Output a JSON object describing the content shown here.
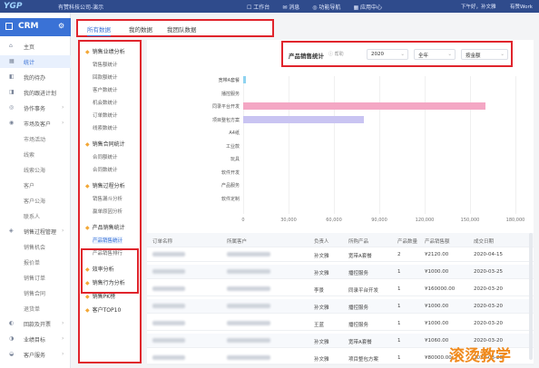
{
  "topbar": {
    "logo": "YGP",
    "company": "有赞科技公司-演示",
    "nav": [
      "工作台",
      "消息",
      "功能导航",
      "应用中心"
    ],
    "user": "下午好，孙文雅",
    "work": "有赞Work"
  },
  "sidebar": {
    "title": "CRM",
    "items": [
      {
        "icon": "⌂",
        "label": "主页"
      },
      {
        "icon": "▦",
        "label": "统计"
      },
      {
        "icon": "◧",
        "label": "我的待办"
      },
      {
        "icon": "◨",
        "label": "我的跟进计划"
      },
      {
        "icon": "◎",
        "label": "协作事务"
      },
      {
        "icon": "◉",
        "label": "市场及客户"
      },
      {
        "icon": "",
        "label": "市场活动"
      },
      {
        "icon": "",
        "label": "线索"
      },
      {
        "icon": "",
        "label": "线索公海"
      },
      {
        "icon": "",
        "label": "客户"
      },
      {
        "icon": "",
        "label": "客户公海"
      },
      {
        "icon": "",
        "label": "联系人"
      },
      {
        "icon": "◈",
        "label": "销售过程管理"
      },
      {
        "icon": "",
        "label": "销售机会"
      },
      {
        "icon": "",
        "label": "报价单"
      },
      {
        "icon": "",
        "label": "销售订单"
      },
      {
        "icon": "",
        "label": "销售合同"
      },
      {
        "icon": "",
        "label": "退货单"
      },
      {
        "icon": "◐",
        "label": "回款及开票"
      },
      {
        "icon": "◑",
        "label": "业绩目标"
      },
      {
        "icon": "◒",
        "label": "客户服务"
      }
    ]
  },
  "tabs": [
    "所有数据",
    "我的数据",
    "我团队数据"
  ],
  "left_panel": {
    "groups": [
      {
        "label": "销售业绩分析",
        "items": [
          "销售额统计",
          "回款额统计",
          "客户数统计",
          "机会数统计",
          "订单数统计",
          "线索数统计"
        ]
      },
      {
        "label": "销售合同统计",
        "items": [
          "合同额统计",
          "合同数统计"
        ]
      },
      {
        "label": "销售过程分析",
        "items": [
          "销售漏斗分析",
          "赢单原因分析"
        ]
      },
      {
        "label": "产品销售统计",
        "items": [
          "产品销售统计",
          "产品销售排行"
        ]
      },
      {
        "label": "效率分析",
        "items": []
      },
      {
        "label": "销售行为分析",
        "items": []
      },
      {
        "label": "销售PK榜",
        "items": []
      },
      {
        "label": "客户TOP10",
        "items": []
      }
    ]
  },
  "filter": {
    "title": "产品销售统计",
    "help": "帮助",
    "year": "2020",
    "period": "全年",
    "metric": "按金额"
  },
  "chart_data": {
    "type": "bar",
    "orientation": "horizontal",
    "categories": [
      "宽带A套餐",
      "播控服务",
      "同录平台开发",
      "项目整包方案",
      "A4纸",
      "工业款",
      "玩具",
      "软件开发",
      "产品服务",
      "软件定制"
    ],
    "values": [
      1500,
      0,
      160000,
      80000,
      0,
      0,
      0,
      0,
      0,
      0
    ],
    "colors": [
      "#8fd3f0",
      "#8fd3f0",
      "#f4a7c4",
      "#c9c4f2",
      "#8fd3f0",
      "#8fd3f0",
      "#8fd3f0",
      "#8fd3f0",
      "#8fd3f0",
      "#8fd3f0"
    ],
    "xticks": [
      "0",
      "30,000",
      "60,000",
      "90,000",
      "120,000",
      "150,000",
      "180,000"
    ],
    "xlim": [
      0,
      180000
    ],
    "grid": true
  },
  "table": {
    "columns": [
      "订单名称",
      "所属客户",
      "负责人",
      "所购产品",
      "产品数量",
      "产品销售额",
      "成交日期"
    ],
    "rows": [
      {
        "owner": "孙文雅",
        "product": "宽带A套餐",
        "qty": "2",
        "amount": "¥2120.00",
        "date": "2020-04-15"
      },
      {
        "owner": "孙文雅",
        "product": "播控服务",
        "qty": "1",
        "amount": "¥1000.00",
        "date": "2020-03-25"
      },
      {
        "owner": "李景",
        "product": "同录平台开发",
        "qty": "1",
        "amount": "¥160000.00",
        "date": "2020-03-20"
      },
      {
        "owner": "孙文雅",
        "product": "播控服务",
        "qty": "1",
        "amount": "¥1000.00",
        "date": "2020-03-20"
      },
      {
        "owner": "王蓝",
        "product": "播控服务",
        "qty": "1",
        "amount": "¥1000.00",
        "date": "2020-03-20"
      },
      {
        "owner": "孙文雅",
        "product": "宽带A套餐",
        "qty": "1",
        "amount": "¥1060.00",
        "date": "2020-03-20"
      },
      {
        "owner": "孙文雅",
        "product": "项目整包方案",
        "qty": "1",
        "amount": "¥80000.00",
        "date": "2020-03-20"
      }
    ]
  },
  "watermark": "滚烫教学"
}
